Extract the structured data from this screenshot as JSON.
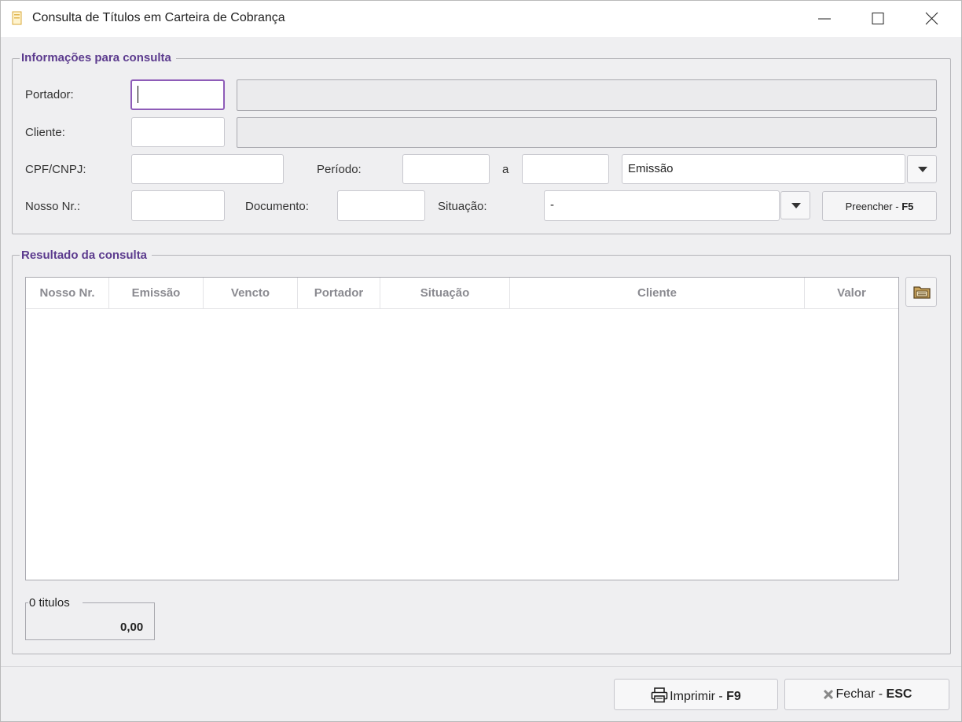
{
  "window": {
    "title": "Consulta de Títulos em Carteira de Cobrança",
    "icon": "document-icon",
    "controls": [
      "minimize-icon",
      "maximize-icon",
      "close-icon"
    ]
  },
  "search": {
    "legend": "Informações para consulta",
    "portador_label": "Portador:",
    "portador_code": "",
    "portador_name": "",
    "cliente_label": "Cliente:",
    "cliente_code": "",
    "cliente_name": "",
    "cpf_label": "CPF/CNPJ:",
    "cpf_value": "",
    "periodo_label": "Período:",
    "periodo_from": "",
    "periodo_sep": "a",
    "periodo_to": "",
    "periodo_type": "Emissão",
    "nosso_label": "Nosso Nr.:",
    "nosso_value": "",
    "documento_label": "Documento:",
    "documento_value": "",
    "situacao_label": "Situação:",
    "situacao_value": "-",
    "fill_button": "Preencher - ",
    "fill_key": "F5"
  },
  "results": {
    "legend": "Resultado da consulta",
    "columns": [
      "Nosso Nr.",
      "Emissão",
      "Vencto",
      "Portador",
      "Situação",
      "Cliente",
      "Valor"
    ],
    "rows": [],
    "count_label": "0 titulos",
    "total": "0,00",
    "export_icon": "folder-icon"
  },
  "footer": {
    "print_label": "Imprimir - ",
    "print_key": "F9",
    "close_label": "Fechar - ",
    "close_key": "ESC"
  },
  "colors": {
    "accent": "#5c3b8e",
    "focus": "#8e5cb8"
  }
}
